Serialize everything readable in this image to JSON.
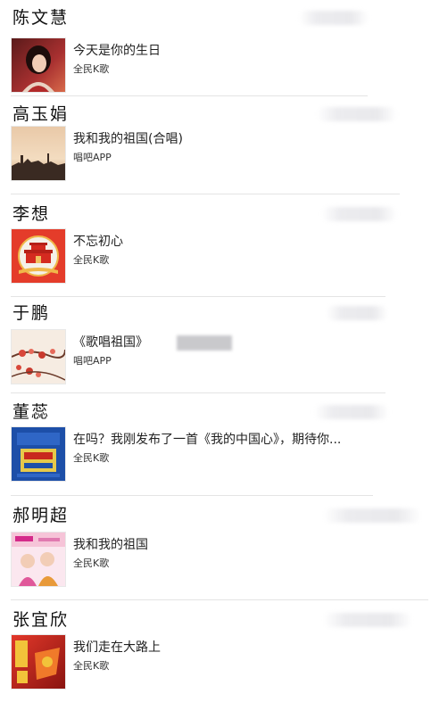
{
  "posts": [
    {
      "author": "陈文慧",
      "title": "今天是你的生日",
      "source": "全民K歌",
      "icon": "portrait-thumb-icon",
      "accent": "#b8322e"
    },
    {
      "author": "高玉娟",
      "title": "我和我的祖国(合唱)",
      "source": "唱吧APP",
      "icon": "sunset-thumb-icon",
      "accent": "#d8a070"
    },
    {
      "author": "李想",
      "title": "不忘初心",
      "source": "全民K歌",
      "icon": "gate-thumb-icon",
      "accent": "#d42a20"
    },
    {
      "author": "于鹏",
      "title": "《歌唱祖国》",
      "source": "唱吧APP",
      "icon": "flower-thumb-icon",
      "accent": "#c84b3a"
    },
    {
      "author": "董蕊",
      "title": "在吗？我刚发布了一首《我的中国心》，期待你...",
      "source": "全民K歌",
      "icon": "album-blue-thumb-icon",
      "accent": "#1a4aa0"
    },
    {
      "author": "郝明超",
      "title": "我和我的祖国",
      "source": "全民K歌",
      "icon": "album-poster-thumb-icon",
      "accent": "#e07ab0"
    },
    {
      "author": "张宜欣",
      "title": "我们走在大路上",
      "source": "全民K歌",
      "icon": "album-red-thumb-icon",
      "accent": "#c82020"
    }
  ]
}
